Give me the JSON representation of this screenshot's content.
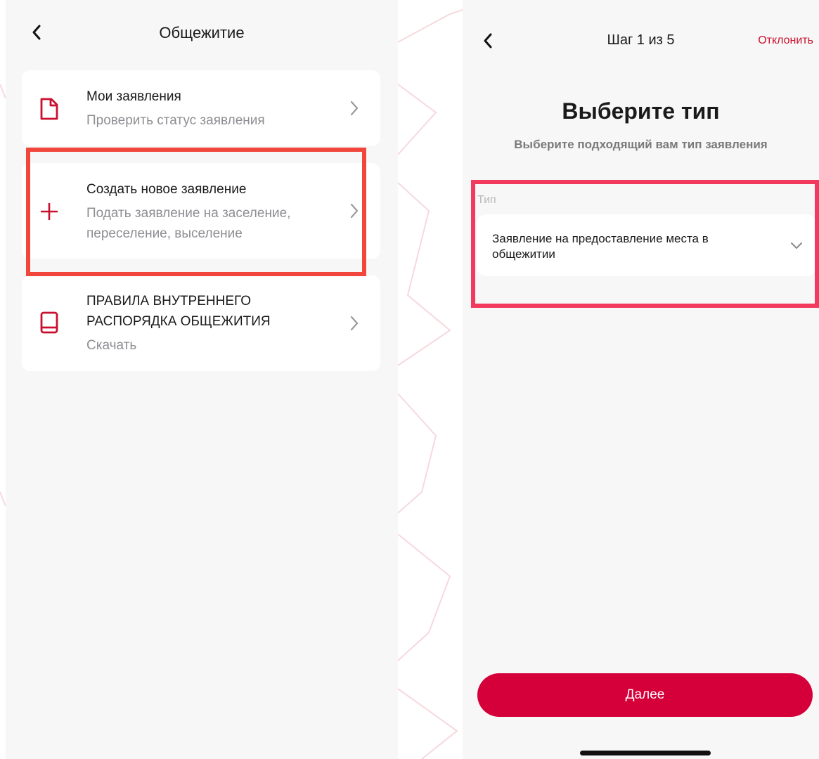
{
  "colors": {
    "accent": "#d5003a",
    "highlight_left": "#f1463b",
    "highlight_right": "#f23a5e",
    "screen_bg": "#f7f7f7",
    "card_bg": "#ffffff",
    "muted_text": "#8e8e93"
  },
  "left_screen": {
    "back_icon": "chevron-left-icon",
    "title": "Общежитие",
    "cards": [
      {
        "icon": "document-icon",
        "title": "Мои заявления",
        "subtitle": "Проверить статус заявления",
        "chevron": "chevron-right-icon"
      },
      {
        "icon": "plus-icon",
        "title": "Создать новое заявление",
        "subtitle": "Подать заявление на заселение, переселение, выселение",
        "chevron": "chevron-right-icon",
        "highlighted": true
      },
      {
        "icon": "book-icon",
        "title": "ПРАВИЛА ВНУТРЕННЕГО РАСПОРЯДКА ОБЩЕЖИТИЯ",
        "subtitle": "Скачать",
        "chevron": "chevron-right-icon"
      }
    ]
  },
  "right_screen": {
    "back_icon": "chevron-left-icon",
    "step_label": "Шаг 1 из 5",
    "decline_label": "Отклонить",
    "title": "Выберите тип",
    "subtitle": "Выберите подходящий вам тип заявления",
    "field_label": "Тип",
    "selected_value": "Заявление на предоставление места в общежитии",
    "select_icon": "chevron-down-icon",
    "next_button_label": "Далее"
  }
}
